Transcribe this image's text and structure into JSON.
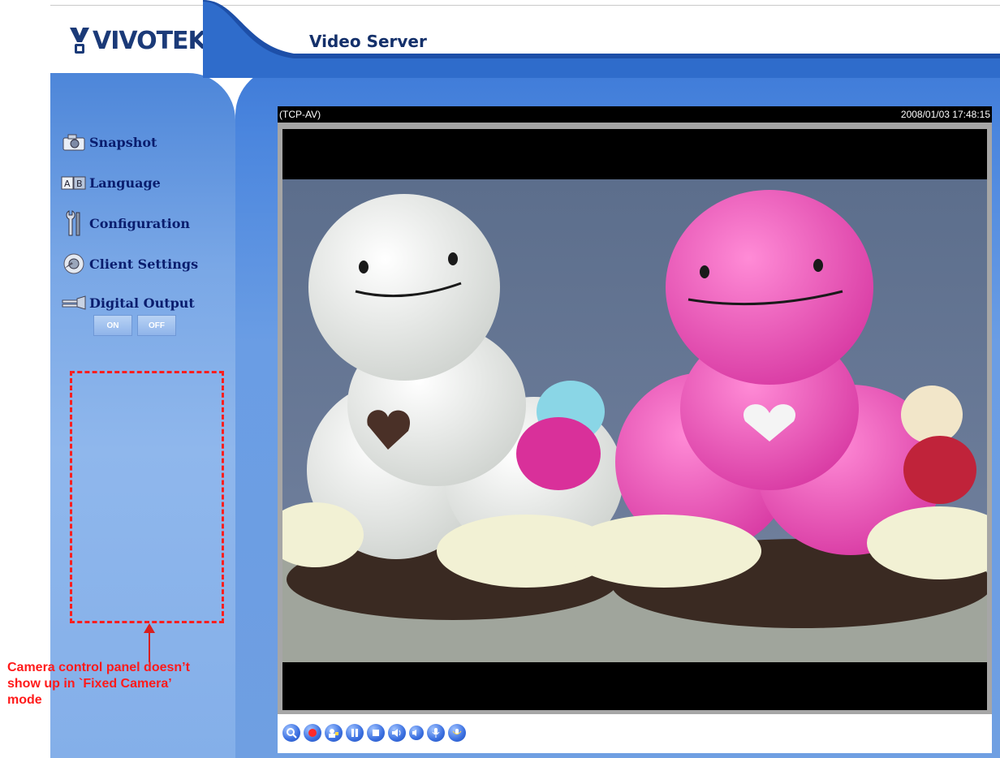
{
  "header": {
    "logo_text": "VIVOTEK",
    "title": "Video Server"
  },
  "sidebar": {
    "items": [
      {
        "label": "Snapshot",
        "icon": "camera-icon"
      },
      {
        "label": "Language",
        "icon": "language-ab-icon"
      },
      {
        "label": "Configuration",
        "icon": "tools-icon"
      },
      {
        "label": "Client Settings",
        "icon": "client-settings-icon"
      },
      {
        "label": "Digital Output",
        "icon": "digital-output-icon"
      }
    ],
    "digital_output": {
      "on_label": "ON",
      "off_label": "OFF"
    }
  },
  "annotation": {
    "line1": "Camera control panel doesn’t",
    "line2": "show   up   in   `Fixed   Camera’",
    "line3": "mode"
  },
  "video": {
    "protocol": "(TCP-AV)",
    "timestamp": "2008/01/03 17:48:15"
  },
  "toolbar": {
    "buttons": [
      "zoom-icon",
      "record-icon",
      "snapshot-person-icon",
      "pause-icon",
      "stop-icon",
      "volume-icon",
      "mute-icon",
      "talk-icon",
      "microphone-icon"
    ]
  },
  "colors": {
    "sidebar_blue": "#79a7e6",
    "nav_text": "#0a1d6e",
    "annotation_red": "#ff1a1a",
    "accent_blue": "#2f6ccb"
  }
}
